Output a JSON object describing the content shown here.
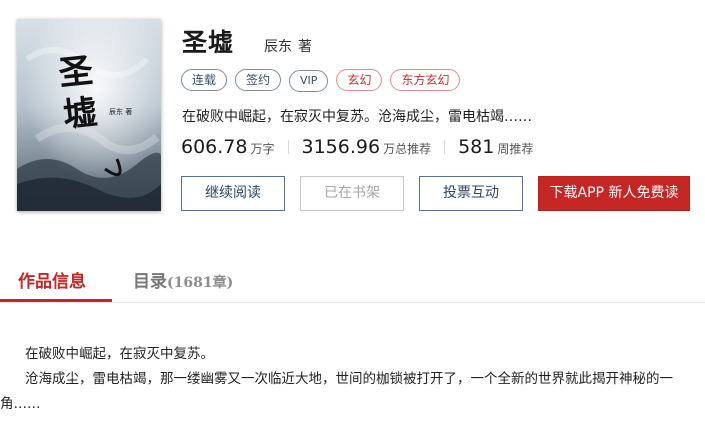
{
  "book": {
    "title": "圣墟",
    "author": "辰东",
    "author_suffix": "著",
    "cover": {
      "title_art": "圣墟",
      "author_art": "辰东 著"
    },
    "tags": [
      {
        "label": "连载",
        "style": "blue"
      },
      {
        "label": "签约",
        "style": "blue"
      },
      {
        "label": "VIP",
        "style": "blue"
      },
      {
        "label": "玄幻",
        "style": "red"
      },
      {
        "label": "东方玄幻",
        "style": "red"
      }
    ],
    "intro": "在破败中崛起，在寂灭中复苏。沧海成尘，雷电枯竭……",
    "stats": [
      {
        "value": "606.78",
        "unit": "万字"
      },
      {
        "value": "3156.96",
        "unit": "万总推荐"
      },
      {
        "value": "581",
        "unit": "周推荐"
      }
    ]
  },
  "actions": {
    "continue_reading": "继续阅读",
    "in_shelf": "已在书架",
    "vote": "投票互动",
    "download": "下载APP 新人免费读"
  },
  "tabs": {
    "info": "作品信息",
    "toc": "目录",
    "toc_count": "(1681章)"
  },
  "description": {
    "para1": "在破败中崛起，在寂灭中复苏。",
    "para2_line1": "沧海成尘，雷电枯竭，那一缕幽雾又一次临近大地，世间的枷锁被打开了，一个全新的世界就此揭开神秘的一",
    "para2_line2": "角……"
  },
  "colors": {
    "accent_red": "#c52725",
    "tag_blue": "#3a4e6b",
    "button_blue": "#2d4566"
  }
}
